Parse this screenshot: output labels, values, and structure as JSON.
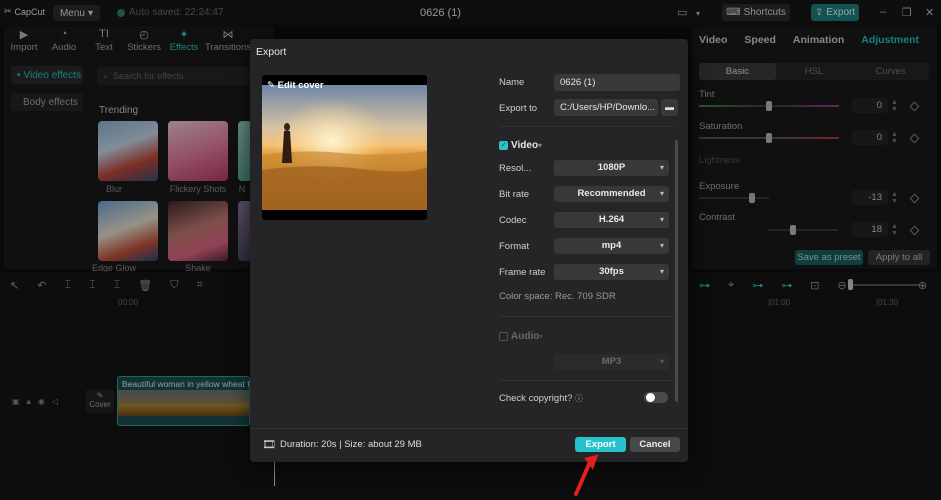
{
  "app": {
    "logo": "CapCut",
    "menu_label": "Menu",
    "autosave": "Auto saved: 22:24:47",
    "doc_title": "0626 (1)",
    "shortcuts_label": "Shortcuts",
    "export_label": "Export"
  },
  "left_tabs": [
    {
      "label": "Import",
      "icon": "import-icon"
    },
    {
      "label": "Audio",
      "icon": "audio-icon"
    },
    {
      "label": "Text",
      "icon": "text-icon"
    },
    {
      "label": "Stickers",
      "icon": "stickers-icon"
    },
    {
      "label": "Effects",
      "icon": "effects-icon",
      "active": true
    },
    {
      "label": "Transitions",
      "icon": "transitions-icon"
    }
  ],
  "left_sidebar": {
    "items": [
      "Video effects",
      "Body effects"
    ]
  },
  "effects": {
    "search_placeholder": "Search for effects",
    "section": "Trending",
    "thumbs": [
      "Blur",
      "Flickery Shots",
      "N",
      "Edge Glow",
      "Shake",
      ""
    ]
  },
  "right_panel": {
    "tabs": [
      "Video",
      "Speed",
      "Animation",
      "Adjustment"
    ],
    "active_tab": "Adjustment",
    "segments": [
      "Basic",
      "HSL",
      "Curves"
    ],
    "tint_label": "Tint",
    "tint_value": "0",
    "saturation_label": "Saturation",
    "saturation_value": "0",
    "lightness_label": "Lightness",
    "exposure_label": "Exposure",
    "exposure_value": "-13",
    "contrast_label": "Contrast",
    "contrast_value": "18",
    "save_preset": "Save as preset",
    "apply_all": "Apply to all"
  },
  "timeline": {
    "ruler_left": "00:00",
    "ruler_mid": "|01:00",
    "ruler_right": "|01:30",
    "cover_label": "Cover",
    "clip_name": "Beautiful woman in yellow wheat fie"
  },
  "export_dialog": {
    "title": "Export",
    "edit_cover": "Edit cover",
    "name_label": "Name",
    "name_value": "0626 (1)",
    "export_to_label": "Export to",
    "export_to_value": "C:/Users/HP/Downlo...",
    "video_section": "Video",
    "resolution_label": "Resol...",
    "resolution_value": "1080P",
    "bitrate_label": "Bit rate",
    "bitrate_value": "Recommended",
    "codec_label": "Codec",
    "codec_value": "H.264",
    "format_label": "Format",
    "format_value": "mp4",
    "framerate_label": "Frame rate",
    "framerate_value": "30fps",
    "color_space": "Color space: Rec. 709 SDR",
    "audio_section": "Audio",
    "audio_format_value": "MP3",
    "copyright_label": "Check copyright?",
    "duration_info": "Duration: 20s | Size: about 29 MB",
    "export_button": "Export",
    "cancel_button": "Cancel"
  },
  "colors": {
    "accent": "#2bc3c7",
    "export_button": "#26c3cc",
    "annotation_arrow": "#e02020"
  }
}
